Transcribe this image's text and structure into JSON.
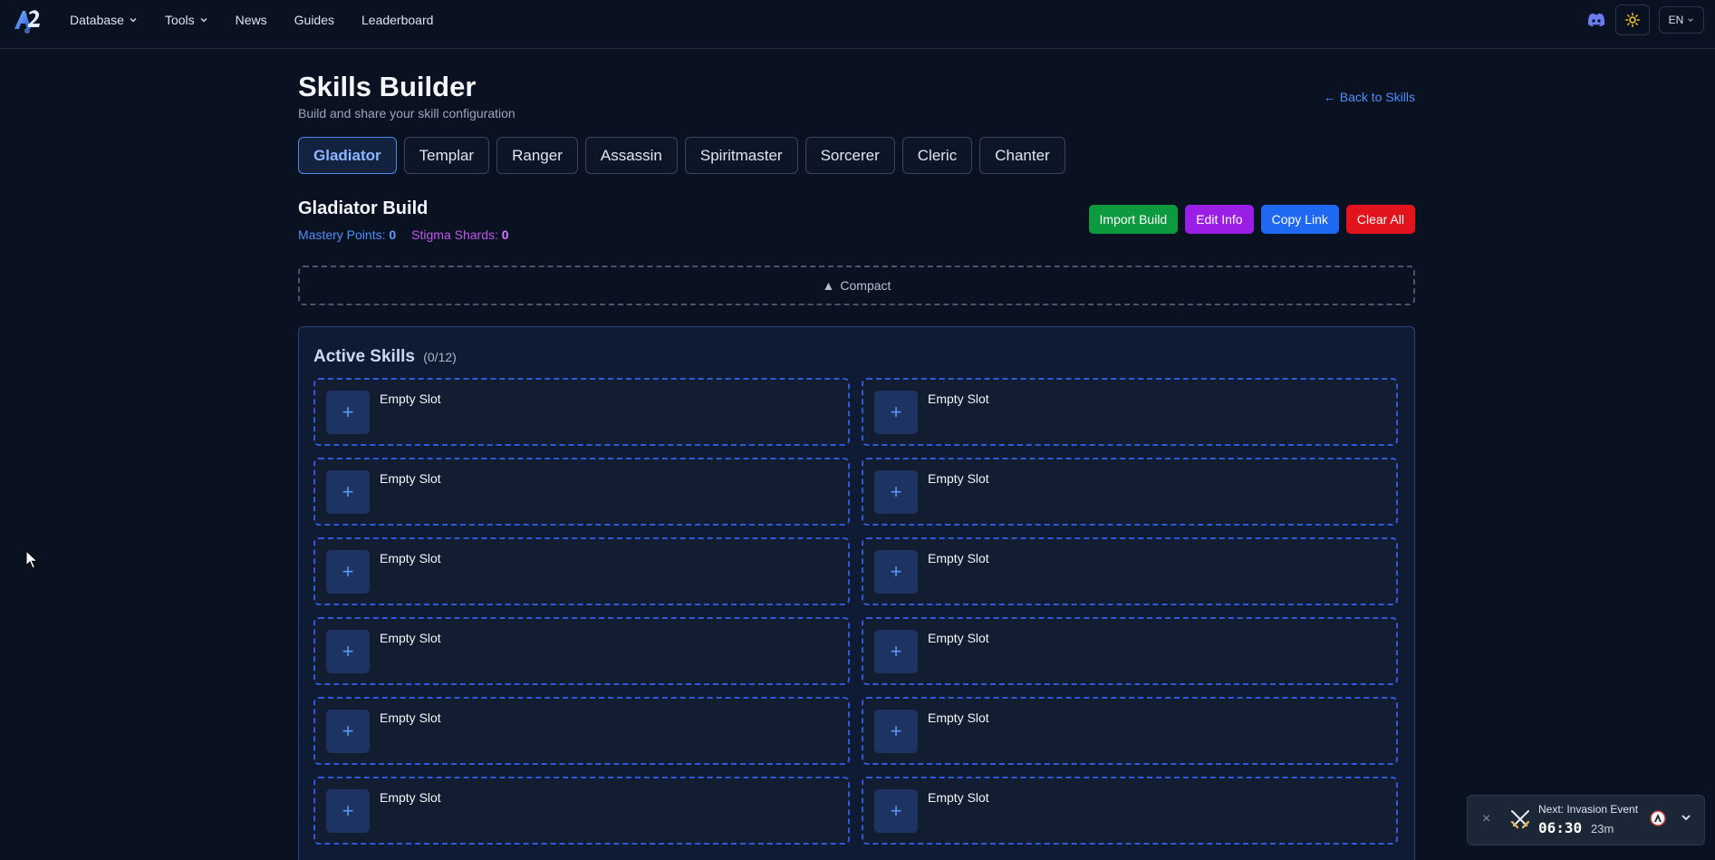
{
  "nav": {
    "items": [
      {
        "label": "Database",
        "dropdown": true
      },
      {
        "label": "Tools",
        "dropdown": true
      },
      {
        "label": "News",
        "dropdown": false
      },
      {
        "label": "Guides",
        "dropdown": false
      },
      {
        "label": "Leaderboard",
        "dropdown": false
      }
    ],
    "language": "EN",
    "icons": {
      "logo": "a2-logo",
      "discord": "discord-icon",
      "theme": "sun-icon"
    }
  },
  "header": {
    "title": "Skills Builder",
    "subtitle": "Build and share your skill configuration",
    "back_link": "← Back to Skills"
  },
  "class_tabs": [
    {
      "label": "Gladiator",
      "active": true
    },
    {
      "label": "Templar",
      "active": false
    },
    {
      "label": "Ranger",
      "active": false
    },
    {
      "label": "Assassin",
      "active": false
    },
    {
      "label": "Spiritmaster",
      "active": false
    },
    {
      "label": "Sorcerer",
      "active": false
    },
    {
      "label": "Cleric",
      "active": false
    },
    {
      "label": "Chanter",
      "active": false
    }
  ],
  "build": {
    "title": "Gladiator Build",
    "mastery_label": "Mastery Points:",
    "mastery_value": "0",
    "stigma_label": "Stigma Shards:",
    "stigma_value": "0"
  },
  "actions": {
    "import": "Import Build",
    "edit": "Edit Info",
    "copy": "Copy Link",
    "clear": "Clear All"
  },
  "compact": {
    "icon": "▲",
    "label": "Compact"
  },
  "active_skills": {
    "title": "Active Skills",
    "count": "(0/12)",
    "slots": [
      {
        "label": "Empty Slot"
      },
      {
        "label": "Empty Slot"
      },
      {
        "label": "Empty Slot"
      },
      {
        "label": "Empty Slot"
      },
      {
        "label": "Empty Slot"
      },
      {
        "label": "Empty Slot"
      },
      {
        "label": "Empty Slot"
      },
      {
        "label": "Empty Slot"
      },
      {
        "label": "Empty Slot"
      },
      {
        "label": "Empty Slot"
      },
      {
        "label": "Empty Slot"
      },
      {
        "label": "Empty Slot"
      }
    ]
  },
  "event": {
    "label": "Next: Invasion Event",
    "time": "06:30",
    "relative": "23m",
    "close": "×"
  },
  "colors": {
    "background": "#0a1222",
    "accent_blue": "#4f8ef7",
    "stigma_purple": "#c058ea",
    "import_green": "#0d9a3f",
    "edit_purple": "#9a1ee6",
    "copy_blue": "#1f68f1",
    "clear_red": "#e2131d"
  }
}
